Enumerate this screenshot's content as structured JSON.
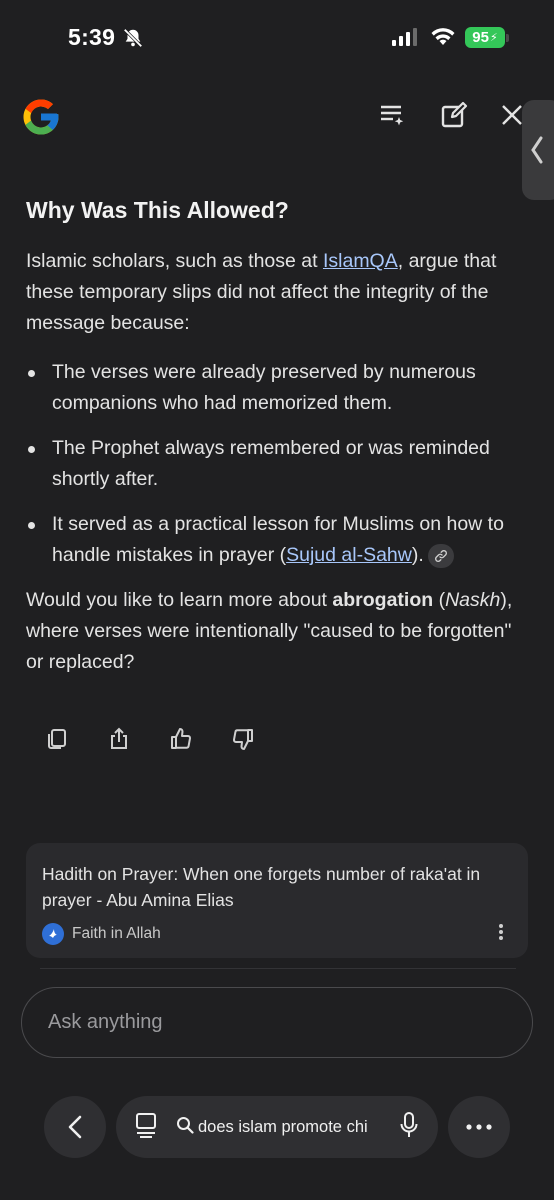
{
  "status_bar": {
    "time": "5:39",
    "battery": "95"
  },
  "header": {
    "icons": [
      "google-g-icon",
      "playlist-sparkle-icon",
      "edit-icon",
      "close-icon"
    ]
  },
  "answer": {
    "heading": "Why Was This Allowed?",
    "intro_before_link": "Islamic scholars, such as those at ",
    "intro_link": "IslamQA",
    "intro_after_link": ", argue that these temporary slips did not affect the integrity of the message because:",
    "bullets": [
      {
        "text": "The verses were already preserved by numerous companions who had memorized them."
      },
      {
        "text": "The Prophet always remembered or was reminded shortly after."
      },
      {
        "before": "It served as a practical lesson for Muslims on how to handle mistakes in prayer (",
        "link": "Sujud al-Sahw",
        "after": ")."
      }
    ],
    "followup_before": "Would you like to learn more about ",
    "followup_bold": "abrogation",
    "followup_mid_open": " (",
    "followup_italic": "Naskh",
    "followup_after": "), where verses were intentionally \"caused to be forgotten\" or replaced?"
  },
  "actions": [
    "copy-icon",
    "share-icon",
    "thumbs-up-icon",
    "thumbs-down-icon"
  ],
  "source_card": {
    "title": "Hadith on Prayer: When one forgets number of raka'at in prayer - Abu Amina Elias",
    "site": "Faith in Allah"
  },
  "input": {
    "placeholder": "Ask anything"
  },
  "bottom_bar": {
    "search_query": "does islam promote chi"
  },
  "colors": {
    "background": "#1f1f21",
    "link": "#a8c7fa",
    "battery": "#34c759"
  }
}
